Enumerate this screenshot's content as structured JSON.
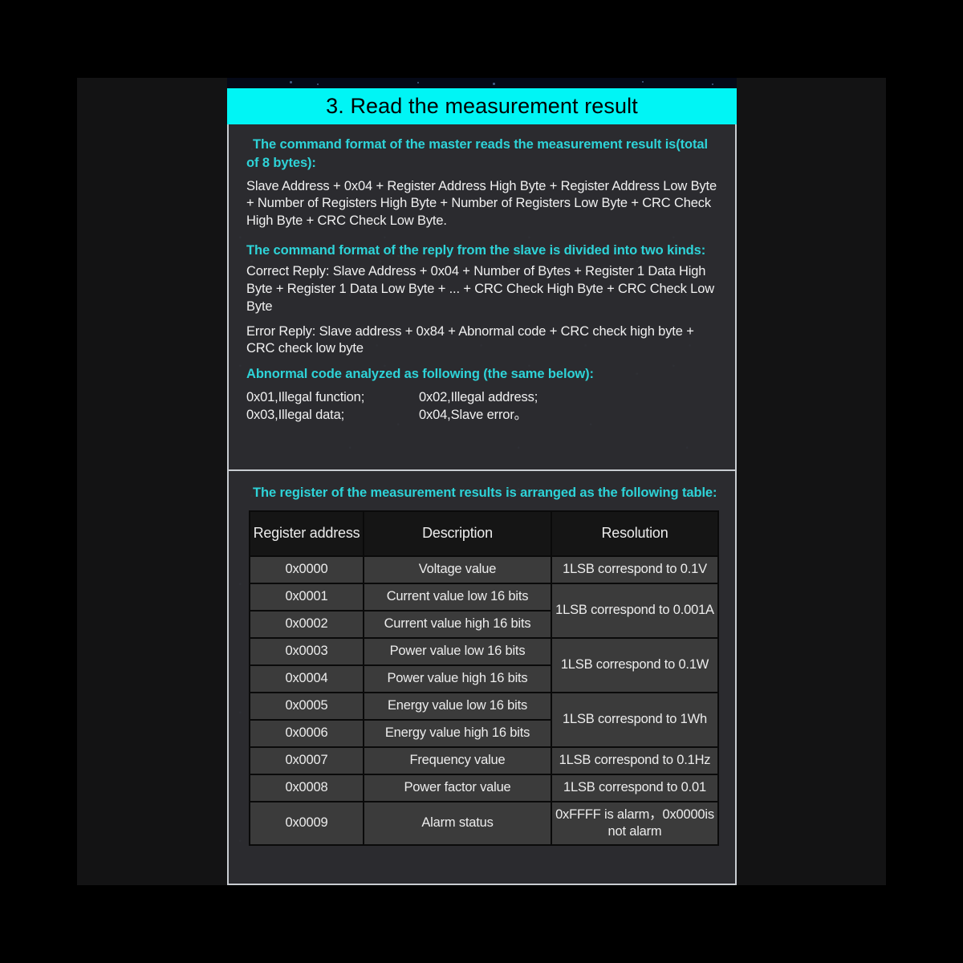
{
  "page": {
    "title": "3. Read the measurement result"
  },
  "section_top": {
    "heading_1": "The command format of the master reads the measurement result is(total of 8 bytes):",
    "paragraph_1": "Slave Address + 0x04 + Register Address High Byte + Register Address Low Byte + Number of Registers High Byte + Number of Registers Low Byte + CRC Check High Byte + CRC Check Low Byte.",
    "heading_2": "The command format of the reply from the slave is divided into two kinds:",
    "paragraph_2": "Correct Reply: Slave Address + 0x04 + Number of Bytes + Register 1 Data High Byte + Register 1 Data Low Byte + ... + CRC Check High Byte + CRC Check Low Byte",
    "paragraph_3": "Error Reply: Slave address + 0x84 + Abnormal code + CRC check high byte + CRC check low byte",
    "heading_3": "Abnormal code analyzed as following (the same below):",
    "abnormal_codes": [
      {
        "left": "0x01,Illegal function;",
        "right": "0x02,Illegal address;"
      },
      {
        "left": "0x03,Illegal data;",
        "right": "0x04,Slave error。"
      }
    ]
  },
  "section_bottom": {
    "heading": "The register of the measurement results is arranged as the following table:",
    "table": {
      "columns": [
        "Register address",
        "Description",
        "Resolution"
      ],
      "rows": [
        {
          "address": "0x0000",
          "description": "Voltage value",
          "resolution": "1LSB correspond to 0.1V",
          "res_rowspan": 1
        },
        {
          "address": "0x0001",
          "description": "Current value low 16 bits",
          "resolution": "1LSB correspond to 0.001A",
          "res_rowspan": 2
        },
        {
          "address": "0x0002",
          "description": "Current value high 16 bits",
          "resolution": null,
          "res_rowspan": 0
        },
        {
          "address": "0x0003",
          "description": "Power value low 16 bits",
          "resolution": "1LSB correspond to 0.1W",
          "res_rowspan": 2
        },
        {
          "address": "0x0004",
          "description": "Power value high 16 bits",
          "resolution": null,
          "res_rowspan": 0
        },
        {
          "address": "0x0005",
          "description": "Energy value low 16 bits",
          "resolution": "1LSB correspond to 1Wh",
          "res_rowspan": 2
        },
        {
          "address": "0x0006",
          "description": "Energy value high 16 bits",
          "resolution": null,
          "res_rowspan": 0
        },
        {
          "address": "0x0007",
          "description": "Frequency value",
          "resolution": "1LSB correspond to 0.1Hz",
          "res_rowspan": 1
        },
        {
          "address": "0x0008",
          "description": "Power factor value",
          "resolution": "1LSB correspond to 0.01",
          "res_rowspan": 1
        },
        {
          "address": "0x0009",
          "description": "Alarm status",
          "resolution": "0xFFFF is alarm，0x0000is not alarm",
          "res_rowspan": 1
        }
      ]
    }
  },
  "colors": {
    "title_bar": "#00F5F5",
    "heading_cyan": "#2ED3D8",
    "panel_background": "#2B2B2F",
    "table_header_background": "#151515",
    "table_cell_background": "#3B3B3B",
    "body_text": "#F0F0F0",
    "page_background": "#000000"
  }
}
